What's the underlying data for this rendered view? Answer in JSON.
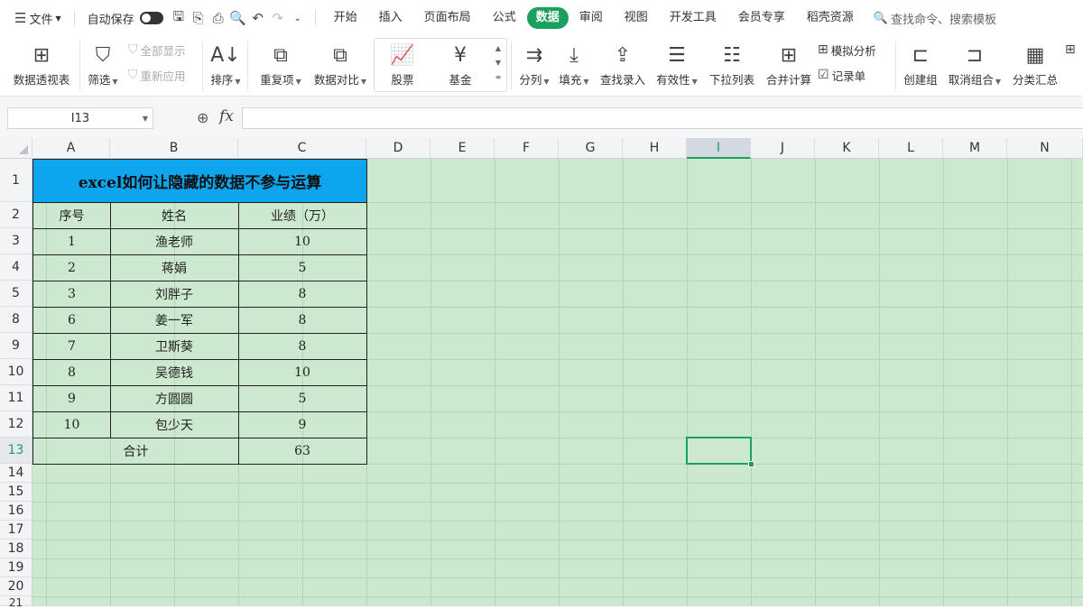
{
  "menubar": {
    "file": "文件",
    "autosave": "自动保存",
    "tabs": [
      "开始",
      "插入",
      "页面布局",
      "公式",
      "数据",
      "审阅",
      "视图",
      "开发工具",
      "会员专享",
      "稻壳资源"
    ],
    "active_tab": "数据",
    "search": "查找命令、搜索模板"
  },
  "ribbon": {
    "pivot": "数据透视表",
    "filter": "筛选",
    "show_all": "全部显示",
    "reapply": "重新应用",
    "sort": "排序",
    "duplicates": "重复项",
    "compare": "数据对比",
    "stocks": "股票",
    "funds": "基金",
    "split": "分列",
    "fill": "填充",
    "lookup": "查找录入",
    "validity": "有效性",
    "dropdown": "下拉列表",
    "consolidate": "合并计算",
    "whatif": "模拟分析",
    "form": "记录单",
    "group": "创建组",
    "ungroup": "取消组合",
    "subtotal": "分类汇总"
  },
  "formula_bar": {
    "name_box": "I13",
    "fx": "fx",
    "formula": ""
  },
  "columns": [
    "A",
    "B",
    "C",
    "D",
    "E",
    "F",
    "G",
    "H",
    "I",
    "J",
    "K",
    "L",
    "M",
    "N"
  ],
  "selected_column": "I",
  "rows": [
    "1",
    "2",
    "3",
    "4",
    "5",
    "8",
    "9",
    "10",
    "11",
    "12",
    "13",
    "14",
    "15",
    "16",
    "17",
    "18",
    "19",
    "20",
    "21"
  ],
  "selected_row": "13",
  "table": {
    "title": "excel如何让隐藏的数据不参与运算",
    "headers": [
      "序号",
      "姓名",
      "业绩（万）"
    ],
    "data": [
      [
        "1",
        "渔老师",
        "10"
      ],
      [
        "2",
        "蒋娟",
        "5"
      ],
      [
        "3",
        "刘胖子",
        "8"
      ],
      [
        "6",
        "姜一军",
        "8"
      ],
      [
        "7",
        "卫斯葵",
        "8"
      ],
      [
        "8",
        "吴德钱",
        "10"
      ],
      [
        "9",
        "方圆圆",
        "5"
      ],
      [
        "10",
        "包少天",
        "9"
      ]
    ],
    "total_label": "合计",
    "total_value": "63"
  },
  "colors": {
    "sheet_bg": "#cce8cf",
    "title_bg": "#0ea5ef",
    "accent": "#1ca060"
  }
}
